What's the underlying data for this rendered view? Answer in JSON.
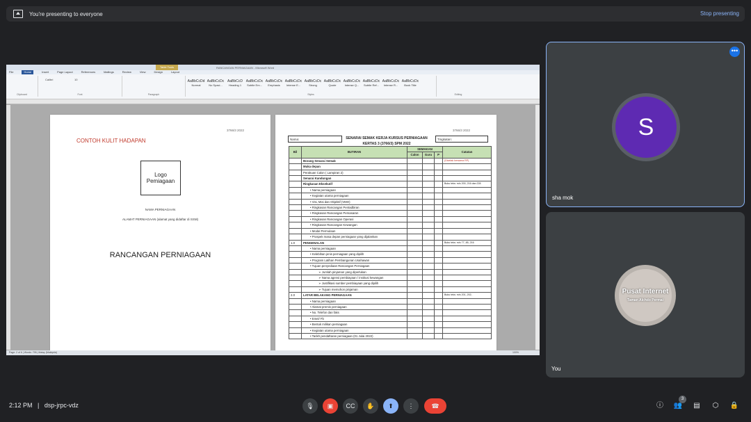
{
  "banner": {
    "text": "You're presenting to everyone",
    "stop_label": "Stop presenting"
  },
  "word": {
    "title_tab": "Table Tools",
    "doc_title": "RANCANGAN PERNIAGAAN - Microsoft Word",
    "tabs": [
      "File",
      "Home",
      "Insert",
      "Page Layout",
      "References",
      "Mailings",
      "Review",
      "View",
      "Design",
      "Layout"
    ],
    "styles": [
      "Normal",
      "No Spaci...",
      "Heading 1",
      "Subtle Em...",
      "Emphasis",
      "Intense E...",
      "Strong",
      "Quote",
      "Intense Q...",
      "Subtle Ref...",
      "Intense R...",
      "Book Title"
    ],
    "groups": [
      "Clipboard",
      "Font",
      "Paragraph",
      "Styles",
      "Editing"
    ],
    "font_name": "Calibri",
    "font_size": "10",
    "status": "Page: 2 of 6  |  Words: 795  |  Malay (Malaysia)",
    "zoom": "100%"
  },
  "page1": {
    "date": "3766/3 2022",
    "heading": "CONTOH KULIT HADAPAN",
    "logo_line1": "Logo",
    "logo_line2": "Pemiagaan",
    "name_line": "NAMA PERNIAGAAN",
    "addr_line": "ALAMAT PERNIAGAAN (alamat yang didaftar di SSM)",
    "title": "RANCANGAN PERNIAGAAN"
  },
  "page2": {
    "date": "3766/3 2022",
    "nama": "Nama:",
    "tingkatan": "Tingkatan:",
    "title1": "SENARAI SEMAK KERJA KURSUS PERNIAGAAN",
    "title2": "KERTAS 3 (3766/3) SPM 2022",
    "headers": {
      "bil": "Bil",
      "butiran": "BUTIRAN",
      "semakan": "SEMAKAN",
      "calon": "Calon",
      "guru": "Guru",
      "p": "P",
      "catatan": "Catatan"
    },
    "rows": [
      {
        "bil": "",
        "text": "Borang Senarai Semak",
        "note": "(Dicetak bersama RP)",
        "cls": "b"
      },
      {
        "bil": "",
        "text": "Muka depan",
        "note": "",
        "cls": "b"
      },
      {
        "bil": "",
        "text": "Perakuan Calon ( Lampiran 2)",
        "note": "",
        "cls": ""
      },
      {
        "bil": "",
        "text": "Senarai Kandungan",
        "note": "",
        "cls": "b"
      },
      {
        "bil": "",
        "text": "Ringkasan Eksekutif",
        "note": "Buku teks: m/s 200, 216 dan 228",
        "cls": "b"
      },
      {
        "bil": "",
        "text": "• Nama perniagaan",
        "note": "",
        "cls": "ind"
      },
      {
        "bil": "",
        "text": "• Kegiatan utama perniagaan",
        "note": "",
        "cls": "ind"
      },
      {
        "bil": "",
        "text": "• Visi, Misi dan Objektif (VMO)",
        "note": "",
        "cls": "ind"
      },
      {
        "bil": "",
        "text": "• Ringkasan Rancangan Pentadbiran",
        "note": "",
        "cls": "ind"
      },
      {
        "bil": "",
        "text": "• Ringkasan Rancangan Pemasaran",
        "note": "",
        "cls": "ind"
      },
      {
        "bil": "",
        "text": "• Ringkasan Rancangan Operasi",
        "note": "",
        "cls": "ind"
      },
      {
        "bil": "",
        "text": "• Ringkasan Rancangan Kewangan",
        "note": "",
        "cls": "ind"
      },
      {
        "bil": "",
        "text": "• Modal Permulaan",
        "note": "",
        "cls": "ind"
      },
      {
        "bil": "",
        "text": "• Prospek masa depan perniagaan yang dijalankan",
        "note": "",
        "cls": "ind"
      },
      {
        "bil": "1.0",
        "text": "PENGENALAN",
        "note": "Buku teks: m/s 77, 85, 216",
        "cls": "b"
      },
      {
        "bil": "",
        "text": "• Nama perniagaan",
        "note": "",
        "cls": "ind"
      },
      {
        "bil": "",
        "text": "• Kelebihan jenis perniagaan yang dipilih",
        "note": "",
        "cls": "ind"
      },
      {
        "bil": "",
        "text": "• Program Latihan Pembangunan Usahawan",
        "note": "",
        "cls": "ind"
      },
      {
        "bil": "",
        "text": "• Tujuan penyediaan Rancangan Perniagaan",
        "note": "",
        "cls": "ind"
      },
      {
        "bil": "",
        "text": "➢ Jumlah pinjaman yang diperlukan",
        "note": "",
        "cls": "ind2"
      },
      {
        "bil": "",
        "text": "➢ Nama agensi pembiayaan / institusi kewangan",
        "note": "",
        "cls": "ind2"
      },
      {
        "bil": "",
        "text": "➢ Justifikasi sumber pembiayaan yang dipilih",
        "note": "",
        "cls": "ind2"
      },
      {
        "bil": "",
        "text": "➢ Tujuan memohon pinjaman",
        "note": "",
        "cls": "ind2"
      },
      {
        "bil": "2.0",
        "text": "LATAR BELAKANG PERNIAGAAN",
        "note": "Buku teks: m/s 201, 202,",
        "cls": "b"
      },
      {
        "bil": "",
        "text": "• Nama perniagaan",
        "note": "",
        "cls": "ind"
      },
      {
        "bil": "",
        "text": "• Alamat premis perniagaan",
        "note": "",
        "cls": "ind"
      },
      {
        "bil": "",
        "text": "• No. Telefon dan faks",
        "note": "",
        "cls": "ind"
      },
      {
        "bil": "",
        "text": "• Emel/ Fb",
        "note": "",
        "cls": "ind"
      },
      {
        "bil": "",
        "text": "• Bentuk milikan perniagaan",
        "note": "",
        "cls": "ind"
      },
      {
        "bil": "",
        "text": "• Kegiatan utama perniagaan",
        "note": "",
        "cls": "ind"
      },
      {
        "bil": "",
        "text": "• Tarikh pendaftaran perniagaan (01 Julai 2022)",
        "note": "",
        "cls": "ind"
      }
    ]
  },
  "participants": [
    {
      "initial": "S",
      "name": "sha mok"
    },
    {
      "name": "You",
      "avatar_line1": "Pusat Internet",
      "avatar_line2": "Taman Alchdo Permai"
    }
  ],
  "bottom": {
    "time": "2:12 PM",
    "separator": "|",
    "meeting_code": "dsp-jrpc-vdz",
    "people_count": "3"
  },
  "colors": {
    "accent": "#8ab4f8",
    "end_call": "#ea4335",
    "avatar_purple": "#5e2ab2"
  }
}
